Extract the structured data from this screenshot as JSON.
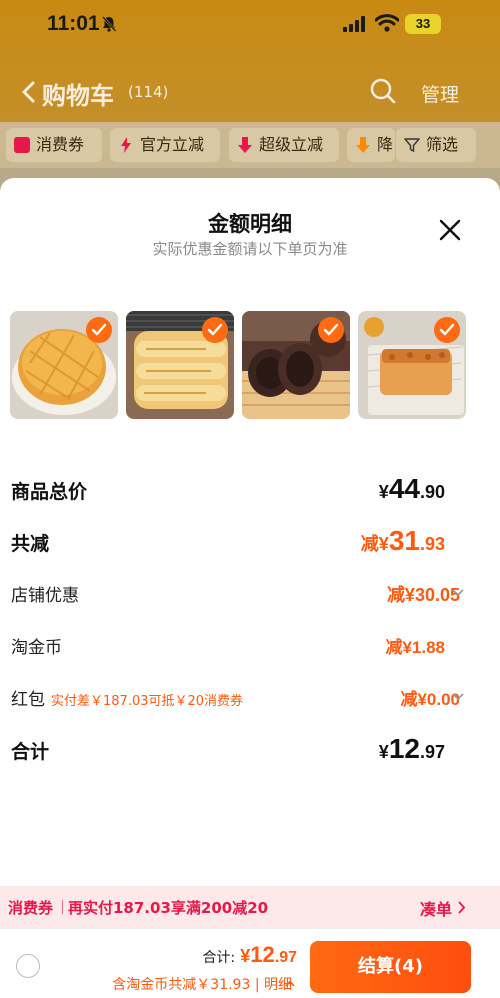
{
  "status_bar": {
    "time": "11:01",
    "battery": "33"
  },
  "nav": {
    "title": "购物车",
    "count": "(114)",
    "manage": "管理"
  },
  "filters": [
    {
      "label": "消费券",
      "icon": "coupon-icon",
      "color": "#e6184a"
    },
    {
      "label": "官方立减",
      "icon": "lightning-icon",
      "color": "#e6184a"
    },
    {
      "label": "超级立减",
      "icon": "down-arrow-icon",
      "color": "#e6184a"
    },
    {
      "label": "降",
      "icon": "down-arrow-icon",
      "color": "#ff8a00"
    },
    {
      "label": "筛选",
      "icon": "filter-icon",
      "color": "#333333"
    }
  ],
  "sheet": {
    "title": "金额明细",
    "subtitle": "实际优惠金额请以下单页为准",
    "products": [
      {
        "name": "pineapple-bun",
        "selected": true
      },
      {
        "name": "cheese-bread",
        "selected": true
      },
      {
        "name": "chocolate-roll",
        "selected": true
      },
      {
        "name": "toast-slice",
        "selected": true
      }
    ],
    "rows": {
      "total_price": {
        "label": "商品总价",
        "currency": "¥",
        "int": "44",
        "dec": ".90"
      },
      "total_reduce": {
        "label": "共减",
        "prefix": "减",
        "currency": "¥",
        "int": "31",
        "dec": ".93"
      },
      "shop_discount": {
        "label": "店铺优惠",
        "value": "减¥30.05"
      },
      "taojinbi": {
        "label": "淘金币",
        "value": "减¥1.88"
      },
      "red_packet": {
        "label": "红包",
        "note": "实付差￥187.03可抵￥20消费券",
        "value": "减¥0.00"
      },
      "sum": {
        "label": "合计",
        "currency": "¥",
        "int": "12",
        "dec": ".97"
      }
    }
  },
  "coupon_bar": {
    "tag": "消费券",
    "text": "再实付187.03享满200减20",
    "action": "凑单"
  },
  "bottom": {
    "total_label": "合计:",
    "total_currency": "¥",
    "total_int": "12",
    "total_dec": ".97",
    "discount_line": "含淘金币共减￥31.93 | 明细",
    "checkout": "结算(4)"
  },
  "colors": {
    "accent": "#ff5a0f",
    "coupon": "#e6184a",
    "header": "#c88a12"
  }
}
